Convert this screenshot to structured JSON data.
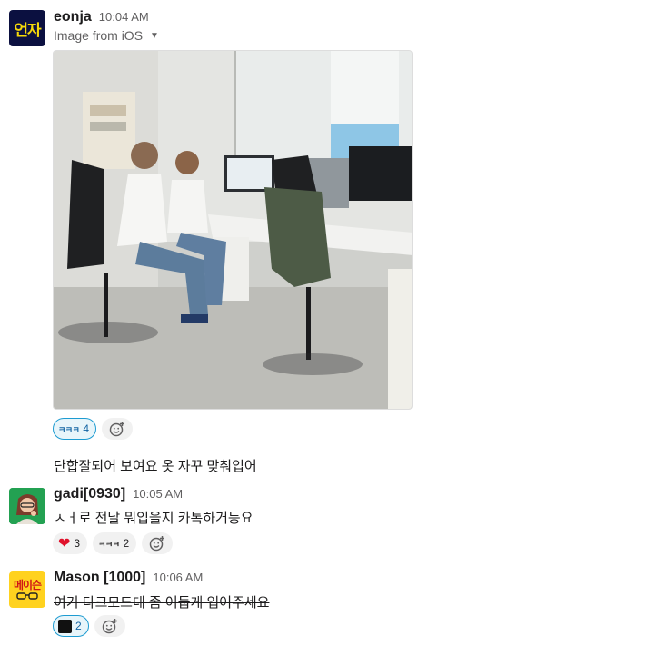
{
  "messages": [
    {
      "author": "eonja",
      "time": "10:04 AM",
      "avatar_text": "언자",
      "file_label": "Image from iOS",
      "reactions": [
        {
          "emoji": "ㅋㅋㅋ",
          "count": "4"
        }
      ]
    },
    {
      "text": "단합잘되어 보여요 옷 자꾸 맞춰입어"
    },
    {
      "author": "gadi[0930]",
      "time": "10:05 AM",
      "text": "ㅅㅓ로 전날 뭐입을지 카톡하거등요",
      "reactions": [
        {
          "emoji": "heart",
          "count": "3"
        },
        {
          "emoji": "ㅋㅋㅋ",
          "count": "2"
        }
      ]
    },
    {
      "author": "Mason [1000]",
      "time": "10:06 AM",
      "avatar_text": "메이슨",
      "text": "여기 다크모드데 좀 어둡게 입어주세요",
      "reactions": [
        {
          "emoji": "black-square",
          "count": "2"
        }
      ]
    }
  ],
  "colors": {
    "eonja_avatar_bg": "#0b1040",
    "eonja_avatar_text": "#f5d90a",
    "mason_avatar_bg": "#ffd21f",
    "accent": "#1264a3"
  }
}
